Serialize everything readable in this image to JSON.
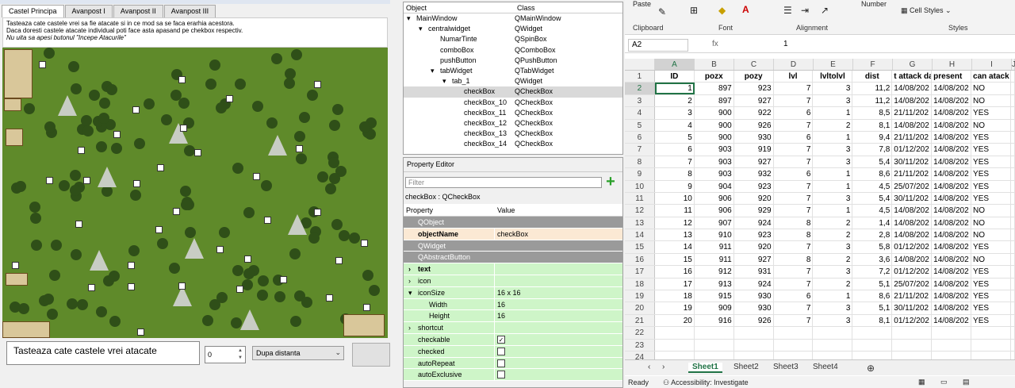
{
  "designer": {
    "tabs": [
      "Castel Principa",
      "Avanpost I",
      "Avanpost II",
      "Avanpost III"
    ],
    "info_lines": [
      "Tasteaza cate castele vrei sa fie atacate si in ce mod sa se faca erarhia acestora.",
      "Daca doresti castele atacate individual poti face asta apasand pe chekbox respectiv.",
      "Nu uita sa apesi butonul \"Incepe Atacurile\""
    ],
    "attack_count_label": "Tasteaza cate castele vrei atacate",
    "spin_value": "0",
    "combo_value": "Dupa distanta"
  },
  "object_inspector": {
    "headers": [
      "Object",
      "Class"
    ],
    "rows": [
      {
        "name": "MainWindow",
        "class": "QMainWindow",
        "indent": 0,
        "expander": "▾"
      },
      {
        "name": "centralwidget",
        "class": "QWidget",
        "indent": 1,
        "expander": "▾"
      },
      {
        "name": "NumarTinte",
        "class": "QSpinBox",
        "indent": 2,
        "expander": ""
      },
      {
        "name": "comboBox",
        "class": "QComboBox",
        "indent": 2,
        "expander": ""
      },
      {
        "name": "pushButton",
        "class": "QPushButton",
        "indent": 2,
        "expander": ""
      },
      {
        "name": "tabWidget",
        "class": "QTabWidget",
        "indent": 2,
        "expander": "▾"
      },
      {
        "name": "tab_1",
        "class": "QWidget",
        "indent": 3,
        "expander": "▾"
      },
      {
        "name": "checkBox",
        "class": "QCheckBox",
        "indent": 4,
        "expander": "",
        "selected": true
      },
      {
        "name": "checkBox_10",
        "class": "QCheckBox",
        "indent": 4,
        "expander": ""
      },
      {
        "name": "checkBox_11",
        "class": "QCheckBox",
        "indent": 4,
        "expander": ""
      },
      {
        "name": "checkBox_12",
        "class": "QCheckBox",
        "indent": 4,
        "expander": ""
      },
      {
        "name": "checkBox_13",
        "class": "QCheckBox",
        "indent": 4,
        "expander": ""
      },
      {
        "name": "checkBox_14",
        "class": "QCheckBox",
        "indent": 4,
        "expander": ""
      }
    ]
  },
  "property_editor": {
    "title": "Property Editor",
    "filter_placeholder": "Filter",
    "object_label": "checkBox : QCheckBox",
    "headers": [
      "Property",
      "Value"
    ],
    "rows": [
      {
        "key": "QObject",
        "value": "",
        "type": "group"
      },
      {
        "key": "objectName",
        "value": "checkBox",
        "type": "obj",
        "bold": true
      },
      {
        "key": "QWidget",
        "value": "",
        "type": "group"
      },
      {
        "key": "QAbstractButton",
        "value": "",
        "type": "group"
      },
      {
        "key": "text",
        "value": "",
        "type": "green",
        "bold": true,
        "exp": "›"
      },
      {
        "key": "icon",
        "value": "",
        "type": "green",
        "exp": "›"
      },
      {
        "key": "iconSize",
        "value": "16 x 16",
        "type": "green",
        "exp": "▾"
      },
      {
        "key": "Width",
        "value": "16",
        "type": "green",
        "indent": true
      },
      {
        "key": "Height",
        "value": "16",
        "type": "green",
        "indent": true
      },
      {
        "key": "shortcut",
        "value": "",
        "type": "green",
        "exp": "›"
      },
      {
        "key": "checkable",
        "value": "",
        "type": "green",
        "check": "✓"
      },
      {
        "key": "checked",
        "value": "",
        "type": "green",
        "check": " "
      },
      {
        "key": "autoRepeat",
        "value": "",
        "type": "green",
        "check": " "
      },
      {
        "key": "autoExclusive",
        "value": "",
        "type": "green",
        "check": " "
      }
    ]
  },
  "excel": {
    "ribbon": {
      "paste": "Paste",
      "number": "Number",
      "cell_styles": "Cell Styles",
      "groups": [
        "Clipboard",
        "Font",
        "Alignment",
        "Styles"
      ]
    },
    "name_box": "A2",
    "fx": "fx",
    "formula_value": "1",
    "columns": [
      "A",
      "B",
      "C",
      "D",
      "E",
      "F",
      "G",
      "H",
      "I",
      "J"
    ],
    "headers": [
      "ID",
      "pozx",
      "pozy",
      "lvl",
      "lvltolvl",
      "dist",
      "t attack da",
      "present",
      "can atack"
    ],
    "rows": [
      [
        "1",
        "897",
        "923",
        "7",
        "3",
        "11,2",
        "14/08/202",
        "14/08/202",
        "NO"
      ],
      [
        "2",
        "897",
        "927",
        "7",
        "3",
        "11,2",
        "14/08/202",
        "14/08/202",
        "NO"
      ],
      [
        "3",
        "900",
        "922",
        "6",
        "1",
        "8,5",
        "21/11/202",
        "14/08/202",
        "YES"
      ],
      [
        "4",
        "900",
        "926",
        "7",
        "2",
        "8,1",
        "14/08/202",
        "14/08/202",
        "NO"
      ],
      [
        "5",
        "900",
        "930",
        "6",
        "1",
        "9,4",
        "21/11/202",
        "14/08/202",
        "YES"
      ],
      [
        "6",
        "903",
        "919",
        "7",
        "3",
        "7,8",
        "01/12/202",
        "14/08/202",
        "YES"
      ],
      [
        "7",
        "903",
        "927",
        "7",
        "3",
        "5,4",
        "30/11/202",
        "14/08/202",
        "YES"
      ],
      [
        "8",
        "903",
        "932",
        "6",
        "1",
        "8,6",
        "21/11/202",
        "14/08/202",
        "YES"
      ],
      [
        "9",
        "904",
        "923",
        "7",
        "1",
        "4,5",
        "25/07/202",
        "14/08/202",
        "YES"
      ],
      [
        "10",
        "906",
        "920",
        "7",
        "3",
        "5,4",
        "30/11/202",
        "14/08/202",
        "YES"
      ],
      [
        "11",
        "906",
        "929",
        "7",
        "1",
        "4,5",
        "14/08/202",
        "14/08/202",
        "NO"
      ],
      [
        "12",
        "907",
        "924",
        "8",
        "2",
        "1,4",
        "14/08/202",
        "14/08/202",
        "NO"
      ],
      [
        "13",
        "910",
        "923",
        "8",
        "2",
        "2,8",
        "14/08/202",
        "14/08/202",
        "NO"
      ],
      [
        "14",
        "911",
        "920",
        "7",
        "3",
        "5,8",
        "01/12/202",
        "14/08/202",
        "YES"
      ],
      [
        "15",
        "911",
        "927",
        "8",
        "2",
        "3,6",
        "14/08/202",
        "14/08/202",
        "NO"
      ],
      [
        "16",
        "912",
        "931",
        "7",
        "3",
        "7,2",
        "01/12/202",
        "14/08/202",
        "YES"
      ],
      [
        "17",
        "913",
        "924",
        "7",
        "2",
        "5,1",
        "25/07/202",
        "14/08/202",
        "YES"
      ],
      [
        "18",
        "915",
        "930",
        "6",
        "1",
        "8,6",
        "21/11/202",
        "14/08/202",
        "YES"
      ],
      [
        "19",
        "909",
        "930",
        "7",
        "3",
        "5,1",
        "30/11/202",
        "14/08/202",
        "YES"
      ],
      [
        "20",
        "916",
        "926",
        "7",
        "3",
        "8,1",
        "01/12/202",
        "14/08/202",
        "YES"
      ]
    ],
    "row_numbers": [
      "1",
      "2",
      "3",
      "4",
      "5",
      "6",
      "7",
      "8",
      "9",
      "10",
      "11",
      "12",
      "13",
      "14",
      "15",
      "16",
      "17",
      "18",
      "19",
      "20",
      "21",
      "22",
      "23",
      "24"
    ],
    "sheets": [
      "Sheet1",
      "Sheet2",
      "Sheet3",
      "Sheet4"
    ],
    "status_ready": "Ready",
    "status_access": "Accessibility: Investigate"
  }
}
